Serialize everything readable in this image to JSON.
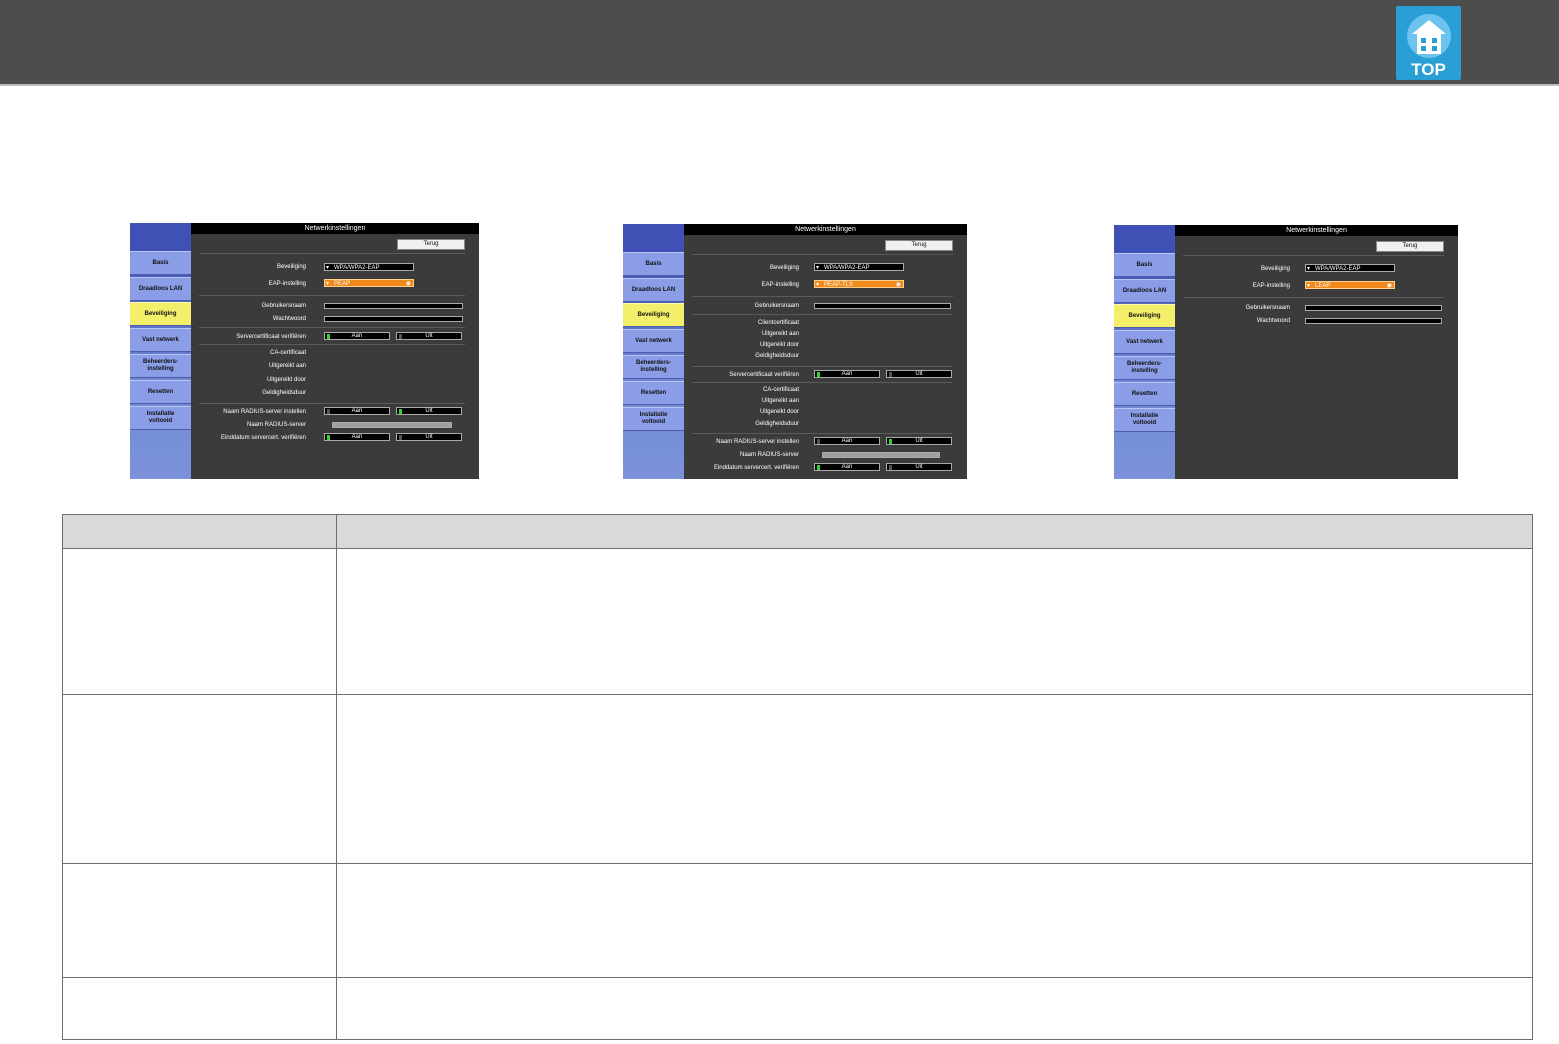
{
  "header": {
    "logo_label": "TOP",
    "logo_icon": "home-icon"
  },
  "colors": {
    "header_bg": "#4d4d4d",
    "sidebar_blue": "#3f51b5",
    "tab_blue": "#8a9de6",
    "tab_active": "#f3ef6a",
    "dropdown_active": "#f08a1c",
    "toggle_on": "#2ed62e"
  },
  "screens": [
    {
      "title": "Netwerkinstellingen",
      "back": "Terug",
      "tabs": [
        "Basis",
        "Draadloos LAN",
        "Beveiliging",
        "Vast netwerk",
        "Beheerders-\ninstelling",
        "Resetten",
        "Installatie\nvoltooid"
      ],
      "active_tab": 2,
      "beveiliging_label": "Beveiliging",
      "beveiliging_value": "WPA/WPA2-EAP",
      "eap_label": "EAP-instelling",
      "eap_value": "PEAP",
      "gebruikersnaam": "Gebruikersnaam",
      "wachtwoord": "Wachtwoord",
      "servercert": "Servercertificaat verifiëren",
      "aan": "Aan",
      "uit": "Uit",
      "ca_cert": "CA-certificaat",
      "uitgereikt_aan": "Uitgereikt aan",
      "uitgereikt_door": "Uitgereikt door",
      "geldigheidsduur": "Geldigheidsduur",
      "radius_instellen": "Naam RADIUS-server instellen",
      "radius_naam": "Naam RADIUS-server",
      "einddatum": "Einddatum servercert. verifiëren"
    },
    {
      "title": "Netwerkinstellingen",
      "back": "Terug",
      "tabs": [
        "Basis",
        "Draadloos LAN",
        "Beveiliging",
        "Vast netwerk",
        "Beheerders-\ninstelling",
        "Resetten",
        "Installatie\nvoltooid"
      ],
      "active_tab": 2,
      "beveiliging_label": "Beveiliging",
      "beveiliging_value": "WPA/WPA2-EAP",
      "eap_label": "EAP-instelling",
      "eap_value": "PEAP-TLS",
      "gebruikersnaam": "Gebruikersnaam",
      "clientcert": "Clientcertificaat",
      "uitgereikt_aan": "Uitgereikt aan",
      "uitgereikt_door": "Uitgereikt door",
      "geldigheidsduur": "Geldigheidsduur",
      "servercert": "Servercertificaat verifiëren",
      "aan": "Aan",
      "uit": "Uit",
      "ca_cert": "CA-certificaat",
      "uitgereikt_aan2": "Uitgereikt aan",
      "uitgereikt_door2": "Uitgereikt door",
      "geldigheidsduur2": "Geldigheidsduur",
      "radius_instellen": "Naam RADIUS-server instellen",
      "radius_naam": "Naam RADIUS-server",
      "einddatum": "Einddatum servercert. verifiëren"
    },
    {
      "title": "Netwerkinstellingen",
      "back": "Terug",
      "tabs": [
        "Basis",
        "Draadloos LAN",
        "Beveiliging",
        "Vast netwerk",
        "Beheerders-\ninstelling",
        "Resetten",
        "Installatie\nvoltooid"
      ],
      "active_tab": 2,
      "beveiliging_label": "Beveiliging",
      "beveiliging_value": "WPA/WPA2-EAP",
      "eap_label": "EAP-instelling",
      "eap_value": "LEAP",
      "gebruikersnaam": "Gebruikersnaam",
      "wachtwoord": "Wachtwoord"
    }
  ]
}
